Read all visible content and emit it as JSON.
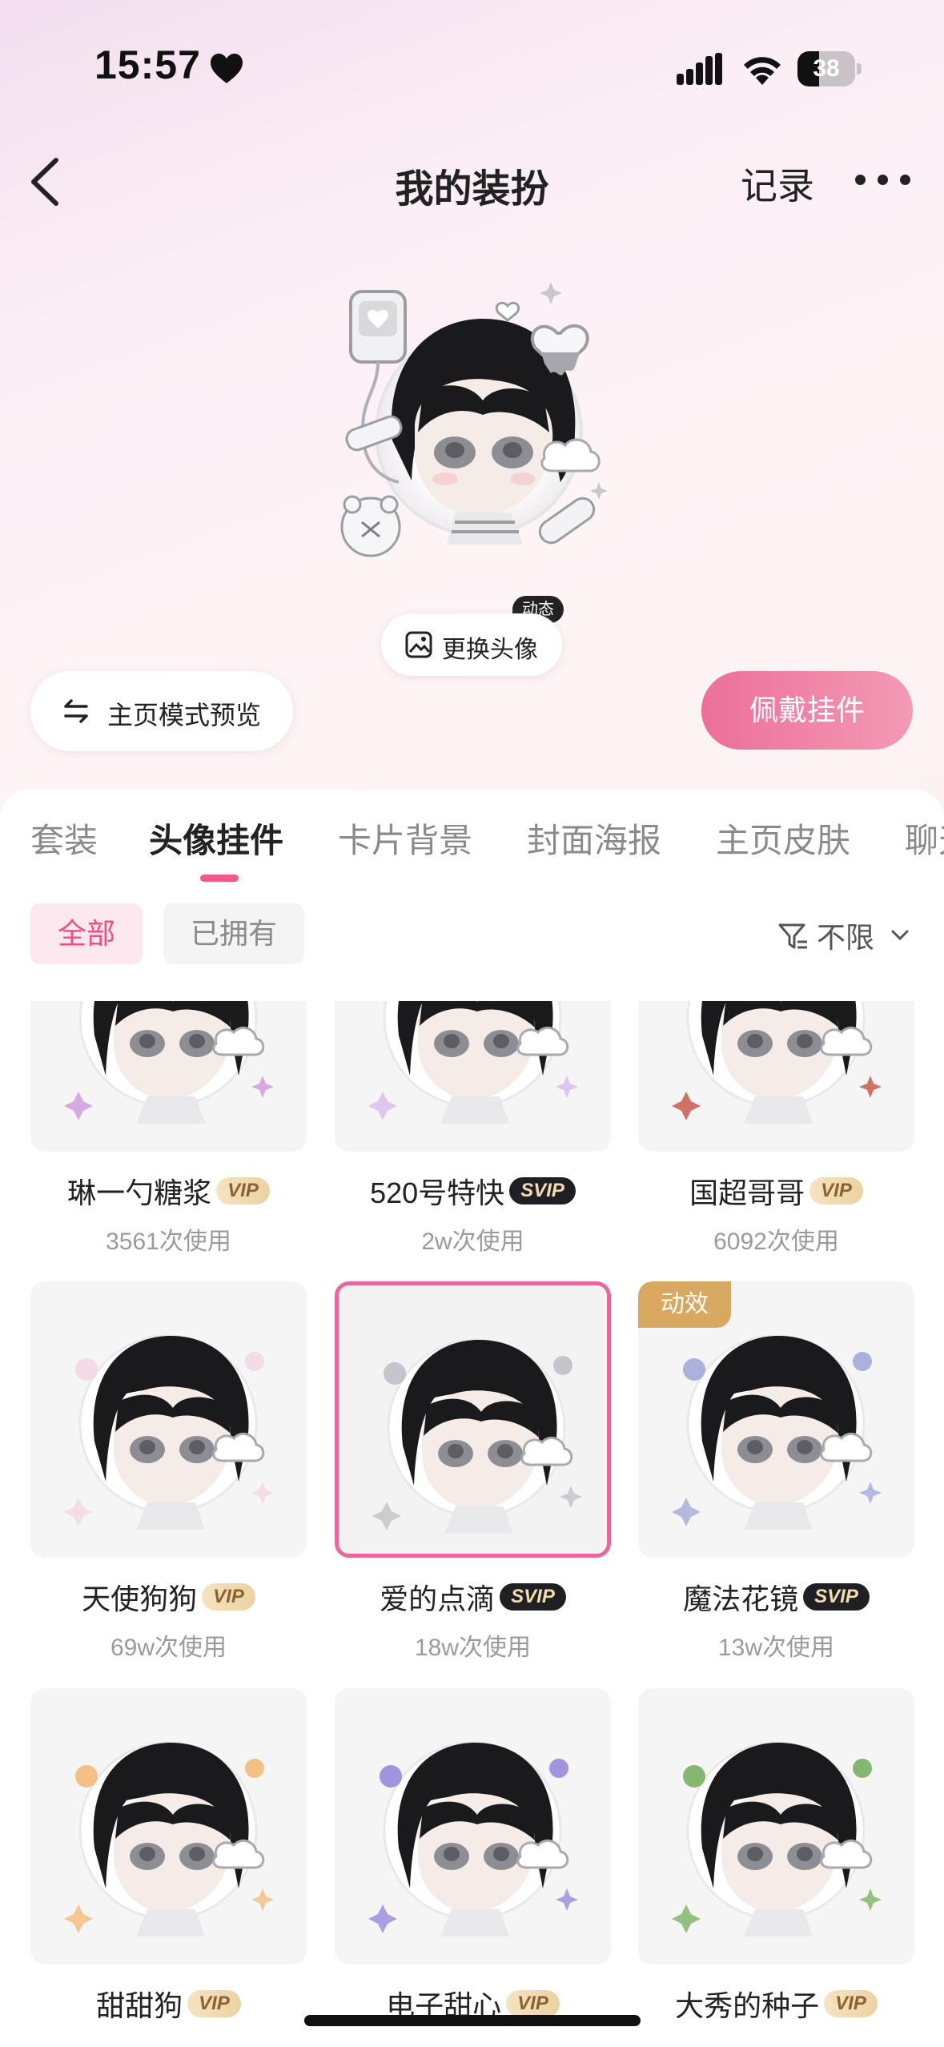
{
  "status_bar": {
    "time": "15:57",
    "battery": "38",
    "battery_level": 0.38
  },
  "nav": {
    "title": "我的装扮",
    "record_label": "记录"
  },
  "hero": {
    "dynamic_badge": "动态",
    "change_avatar_label": "更换头像",
    "mode_preview_label": "主页模式预览",
    "wear_button_label": "佩戴挂件"
  },
  "tabs": [
    "套装",
    "头像挂件",
    "卡片背景",
    "封面海报",
    "主页皮肤",
    "聊天"
  ],
  "active_tab": "头像挂件",
  "filters": {
    "all_label": "全部",
    "owned_label": "已拥有",
    "sort_label": "不限"
  },
  "items": [
    {
      "name": "琳一勺糖浆",
      "badge": "VIP",
      "usage": "3561次使用"
    },
    {
      "name": "520号特快",
      "badge": "SVIP",
      "usage": "2w次使用"
    },
    {
      "name": "国超哥哥",
      "badge": "VIP",
      "usage": "6092次使用"
    },
    {
      "name": "天使狗狗",
      "badge": "VIP",
      "usage": "69w次使用"
    },
    {
      "name": "爱的点滴",
      "badge": "SVIP",
      "usage": "18w次使用",
      "selected": true
    },
    {
      "name": "魔法花镜",
      "badge": "SVIP",
      "usage": "13w次使用",
      "tag": "动效"
    },
    {
      "name": "甜甜狗",
      "badge": "VIP",
      "usage": ""
    },
    {
      "name": "电子甜心",
      "badge": "VIP",
      "usage": ""
    },
    {
      "name": "大秀的种子",
      "badge": "VIP",
      "usage": ""
    }
  ],
  "colors": {
    "accent": "#ee5a8a",
    "vip": "#ecd2a2",
    "svip": "#1f1f24",
    "tag": "#d9a860"
  }
}
